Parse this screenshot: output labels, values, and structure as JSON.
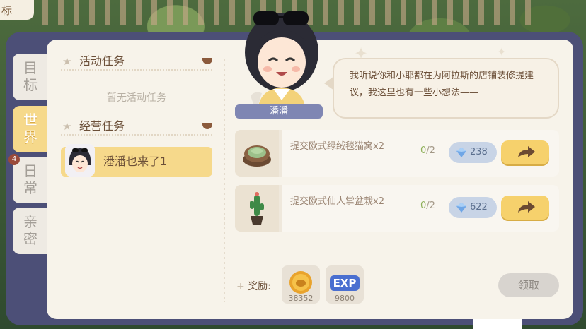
{
  "corner_tab": "标",
  "side_tabs": [
    {
      "label": "目标",
      "active": false
    },
    {
      "label": "世界",
      "active": true
    },
    {
      "label": "日常",
      "active": false,
      "badge": "4"
    },
    {
      "label": "亲密",
      "active": false
    }
  ],
  "sections": {
    "active_title": "活动任务",
    "active_empty": "暂无活动任务",
    "business_title": "经营任务",
    "business_task": "潘潘也来了1"
  },
  "npc": {
    "name": "潘潘",
    "dialogue": "我听说你和小耶都在为阿拉斯的店铺装修提建议，我这里也有一些小想法——"
  },
  "orders": [
    {
      "name": "提交欧式绿绒毯猫窝x2",
      "progress": "0",
      "total": "/2",
      "price": "238"
    },
    {
      "name": "提交欧式仙人掌盆栽x2",
      "progress": "0",
      "total": "/2",
      "price": "622"
    }
  ],
  "reward": {
    "label": "奖励:",
    "coins": "38352",
    "exp_label": "EXP",
    "exp": "9800",
    "claim_label": "领取"
  },
  "colors": {
    "frame": "#4c4f77",
    "panel": "#f7f3ea",
    "accent_yellow": "#f6d98b",
    "nameplate": "#7f86b3"
  }
}
